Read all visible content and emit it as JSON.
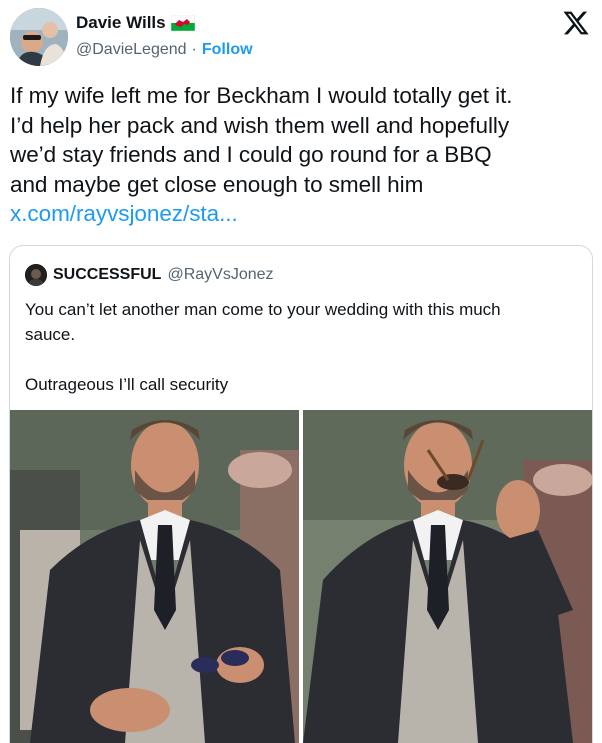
{
  "author": {
    "name": "Davie Wills",
    "flag_icon": "wales-flag-icon",
    "handle": "@DavieLegend",
    "separator": "·",
    "follow_label": "Follow"
  },
  "brand_icon": "x-logo-icon",
  "tweet": {
    "lines": [
      "If my wife left me for Beckham I would totally get it.",
      "I’d help her pack and wish them well and hopefully",
      "we’d stay friends and I could go round for a BBQ",
      "and maybe get close enough to smell him"
    ],
    "link": "x.com/rayvsjonez/sta..."
  },
  "quote": {
    "name": "SUCCESSFUL",
    "handle": "@RayVsJonez",
    "text_lines": [
      "You can’t let another man come to your wedding with this much",
      "sauce."
    ],
    "text_line_2": "Outrageous I’ll call security"
  },
  "colors": {
    "accent": "#1d9bf0",
    "text": "#0f1419",
    "muted": "#536471",
    "border": "#cfd9de"
  }
}
